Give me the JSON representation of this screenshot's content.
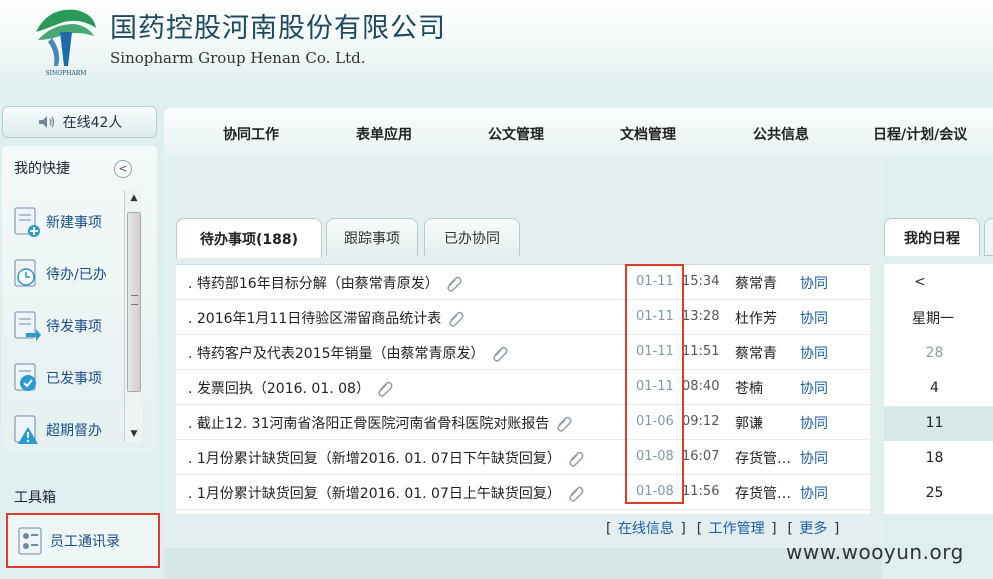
{
  "header": {
    "company_cn": "国药控股河南股份有限公司",
    "company_en": "Sinopharm Group Henan Co. Ltd.",
    "logo_text": "SINOPHARM"
  },
  "sidebar": {
    "online": "在线42人",
    "quick_title": "我的快捷",
    "quick_items": [
      {
        "label": "新建事项",
        "icon": "new-item-icon"
      },
      {
        "label": "待办/已办",
        "icon": "pending-clock-icon"
      },
      {
        "label": "待发事项",
        "icon": "to-send-icon"
      },
      {
        "label": "已发事项",
        "icon": "sent-check-icon"
      },
      {
        "label": "超期督办",
        "icon": "overdue-warning-icon"
      }
    ],
    "tools_title": "工具箱",
    "tool_item": "员工通讯录"
  },
  "nav": [
    "协同工作",
    "表单应用",
    "公文管理",
    "文档管理",
    "公共信息",
    "日程/计划/会议"
  ],
  "tabs": [
    "待办事项(188)",
    "跟踪事项",
    "已办协同"
  ],
  "tasks": [
    {
      "title": ". 特药部16年目标分解（由蔡常青原发）",
      "date": "01-11",
      "time": "15:34",
      "person": "蔡常青",
      "kind": "协同"
    },
    {
      "title": ". 2016年1月11日待验区滞留商品统计表",
      "date": "01-11",
      "time": "13:28",
      "person": "杜作芳",
      "kind": "协同"
    },
    {
      "title": ". 特药客户及代表2015年销量（由蔡常青原发）",
      "date": "01-11",
      "time": "11:51",
      "person": "蔡常青",
      "kind": "协同"
    },
    {
      "title": ". 发票回执（2016. 01. 08）",
      "date": "01-11",
      "time": "08:40",
      "person": "苍楠",
      "kind": "协同"
    },
    {
      "title": ". 截止12. 31河南省洛阳正骨医院河南省骨科医院对账报告",
      "date": "01-06",
      "time": "09:12",
      "person": "郭谦",
      "kind": "协同"
    },
    {
      "title": ". 1月份累计缺货回复（新增2016. 01. 07日下午缺货回复）",
      "date": "01-08",
      "time": "16:07",
      "person": "存货管…",
      "kind": "协同"
    },
    {
      "title": ". 1月份累计缺货回复（新增2016. 01. 07日上午缺货回复）",
      "date": "01-08",
      "time": "11:56",
      "person": "存货管…",
      "kind": "协同"
    }
  ],
  "footer_links": [
    "在线信息",
    "工作管理",
    "更多"
  ],
  "calendar": {
    "tab": "我的日程",
    "prev": "<",
    "weekday": "星期一",
    "days": [
      "28",
      "4",
      "11",
      "18",
      "25"
    ]
  },
  "watermark": "www.wooyun.org",
  "colors": {
    "accent_link": "#1c60a8",
    "highlight_red": "#e23a2a",
    "logo_green": "#2a9a5a",
    "logo_blue": "#1f6aa8"
  }
}
